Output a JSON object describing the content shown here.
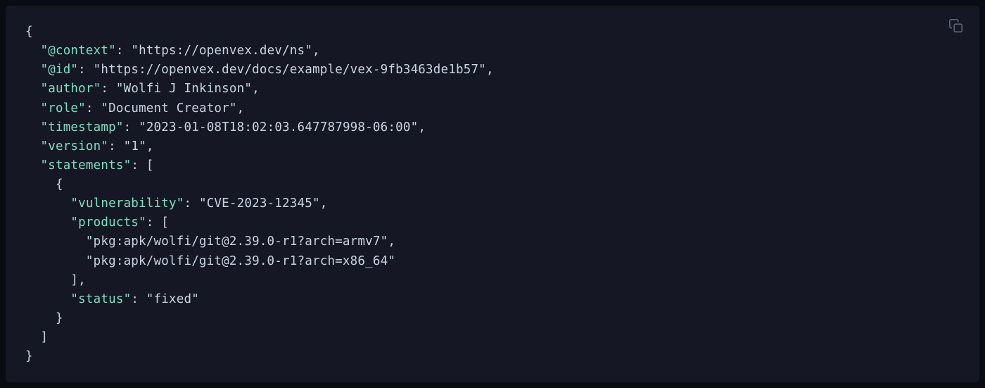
{
  "copy_button_label": "Copy",
  "doc": {
    "context_key": "\"@context\"",
    "context_val": "\"https://openvex.dev/ns\"",
    "id_key": "\"@id\"",
    "id_val": "\"https://openvex.dev/docs/example/vex-9fb3463de1b57\"",
    "author_key": "\"author\"",
    "author_val": "\"Wolfi J Inkinson\"",
    "role_key": "\"role\"",
    "role_val": "\"Document Creator\"",
    "timestamp_key": "\"timestamp\"",
    "timestamp_val": "\"2023-01-08T18:02:03.647787998-06:00\"",
    "version_key": "\"version\"",
    "version_val": "\"1\"",
    "statements_key": "\"statements\"",
    "vulnerability_key": "\"vulnerability\"",
    "vulnerability_val": "\"CVE-2023-12345\"",
    "products_key": "\"products\"",
    "product_0": "\"pkg:apk/wolfi/git@2.39.0-r1?arch=armv7\"",
    "product_1": "\"pkg:apk/wolfi/git@2.39.0-r1?arch=x86_64\"",
    "status_key": "\"status\"",
    "status_val": "\"fixed\""
  },
  "p": {
    "open_brace": "{",
    "close_brace": "}",
    "open_bracket": "[",
    "close_bracket": "]",
    "colon": ": ",
    "comma": ","
  }
}
